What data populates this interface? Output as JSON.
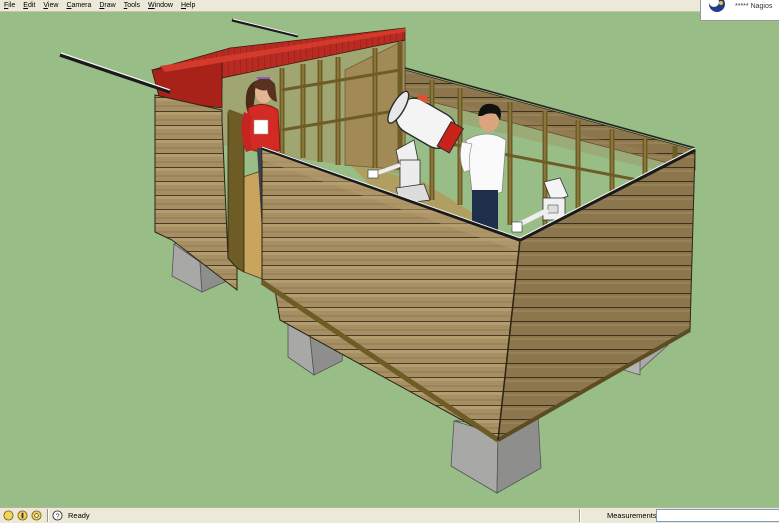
{
  "menu": {
    "items": [
      "File",
      "Edit",
      "View",
      "Camera",
      "Draw",
      "Tools",
      "Window",
      "Help"
    ]
  },
  "logo": {
    "text": "***** Nagios"
  },
  "status": {
    "ready": "Ready",
    "measurements_label": "Measurements",
    "measurements_value": ""
  },
  "colors": {
    "background": "#98bd87",
    "wood_light": "#a58e62",
    "wood_dark": "#6d5a36",
    "frame": "#7a6a2c",
    "roof": "#b52a20",
    "block": "#a9a9a7"
  },
  "icons": [
    "sun-icon",
    "info-icon",
    "help-icon"
  ]
}
